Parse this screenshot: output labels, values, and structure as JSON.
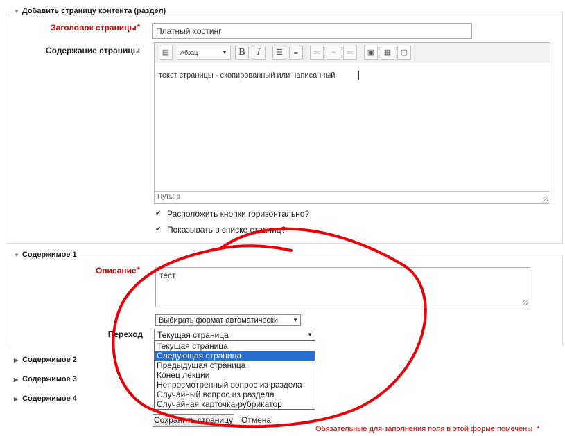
{
  "section1": {
    "legend": "Добавить страницу контента (раздел)",
    "title_label": "Заголовок страницы",
    "title_value": "Платный хостинг",
    "content_label": "Содержание страницы",
    "editor": {
      "format_select": "Абзац",
      "body_text": "текст страницы - скопированный или написанный",
      "path_label": "Путь: p"
    },
    "checkbox_horizontal": "Расположить кнопки горизонтально?",
    "checkbox_show_in_list": "Показывать в списке страниц?"
  },
  "section2": {
    "legend": "Содержимое 1",
    "description_label": "Описание",
    "description_value": "тест",
    "format_select": "Выбирать формат автоматически",
    "jump_label": "Переход",
    "jump_select": "Текущая страница",
    "jump_options": [
      "Текущая страница",
      "Следующая страница",
      "Предыдущая страница",
      "Конец лекции",
      "Непросмотренный вопрос из раздела",
      "Случайный вопрос из раздела",
      "Случайная карточка-рубрикатор"
    ],
    "jump_selected_option": "Следующая страница"
  },
  "collapsed": [
    {
      "label": "Содержимое 2"
    },
    {
      "label": "Содержимое 3"
    },
    {
      "label": "Содержимое 4"
    }
  ],
  "footer": {
    "save_button": "Сохранить страницу",
    "cancel_link": "Отмена",
    "required_note": "Обязательные для заполнения поля в этой форме помечены",
    "required_star": "*"
  },
  "annotation_color": "#e8000a",
  "selection_color": "#2a6fd0"
}
